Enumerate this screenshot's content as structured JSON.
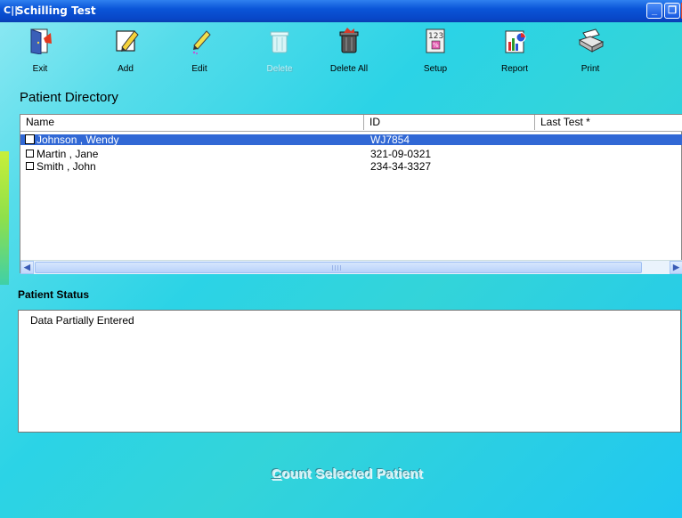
{
  "window": {
    "logo": "C||",
    "title": "Schilling Test",
    "minimize_glyph": "_",
    "restore_glyph": "❐"
  },
  "toolbar": {
    "items": [
      {
        "label": "Exit",
        "icon": "exit-door-icon",
        "enabled": true
      },
      {
        "label": "Add",
        "icon": "add-pencil-icon",
        "enabled": true
      },
      {
        "label": "Edit",
        "icon": "edit-pen-icon",
        "enabled": true
      },
      {
        "label": "Delete",
        "icon": "delete-trash-icon",
        "enabled": false
      },
      {
        "label": "Delete All",
        "icon": "delete-all-trash-icon",
        "enabled": true
      },
      {
        "label": "Setup",
        "icon": "setup-calculator-icon",
        "enabled": true
      },
      {
        "label": "Report",
        "icon": "report-chart-icon",
        "enabled": true
      },
      {
        "label": "Print",
        "icon": "printer-icon",
        "enabled": true
      }
    ]
  },
  "directory": {
    "title": "Patient Directory",
    "columns": [
      "Name",
      "ID",
      "Last Test *"
    ],
    "rows": [
      {
        "name": "Johnson , Wendy",
        "id": "WJ7854",
        "last_test": "",
        "selected": true,
        "checked": false
      },
      {
        "name": "Martin , Jane",
        "id": "321-09-0321",
        "last_test": "",
        "selected": false,
        "checked": false
      },
      {
        "name": "Smith , John",
        "id": "234-34-3327",
        "last_test": "",
        "selected": false,
        "checked": false
      }
    ],
    "scroll_grip": "III"
  },
  "status": {
    "title": "Patient Status",
    "text": "Data Partially Entered"
  },
  "count_button": {
    "accel": "C",
    "rest": "ount Selected Patient"
  },
  "colors": {
    "titlebar": "#0a55d8",
    "selection": "#3168d5",
    "background": "#2bd3e6"
  }
}
